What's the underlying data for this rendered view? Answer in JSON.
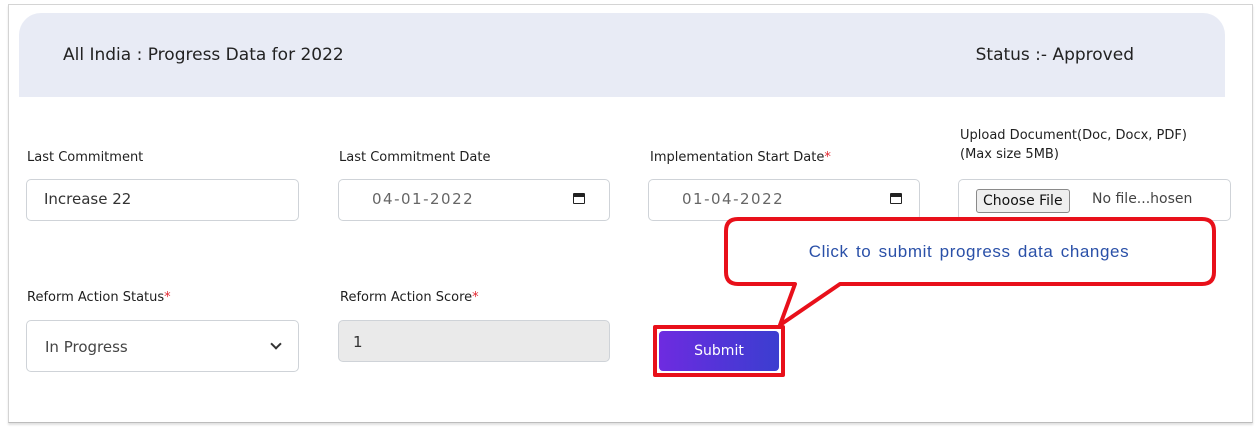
{
  "header": {
    "title": "All India : Progress Data for 2022",
    "status": "Status :- Approved"
  },
  "form": {
    "last_commitment": {
      "label": "Last Commitment",
      "value": "Increase 22"
    },
    "last_commitment_date": {
      "label": "Last Commitment Date",
      "value": "04-01-2022",
      "icon": "calendar-icon"
    },
    "implementation_start_date": {
      "label": "Implementation Start Date",
      "required": "*",
      "value": "01-04-2022",
      "icon": "calendar-icon"
    },
    "upload_document": {
      "label_line1": "Upload Document(Doc, Docx, PDF)",
      "label_line2": "(Max size 5MB)",
      "button": "Choose File",
      "file_text": "No file...hosen"
    },
    "reform_action_status": {
      "label": "Reform Action Status",
      "required": "*",
      "value": "In Progress",
      "icon": "chevron-down-icon"
    },
    "reform_action_score": {
      "label": "Reform Action Score",
      "required": "*",
      "value": "1"
    },
    "submit_label": "Submit"
  },
  "callout": {
    "text": "Click to submit progress data changes",
    "color": "#e8101a",
    "text_color": "#2a50a8"
  },
  "colors": {
    "header_bg": "#e8ebf5",
    "required": "#e3262f",
    "submit_gradient_start": "#6e2be0",
    "submit_gradient_end": "#3b3ed0"
  }
}
